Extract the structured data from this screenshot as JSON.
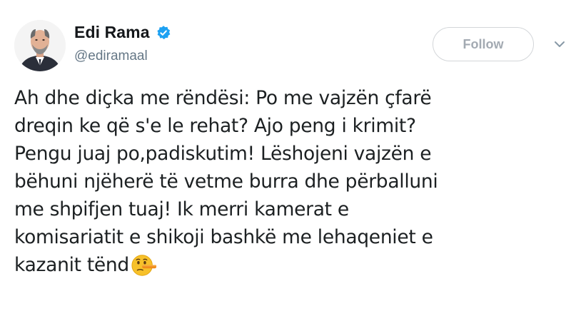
{
  "user": {
    "display_name": "Edi Rama",
    "handle": "@ediramaal"
  },
  "actions": {
    "follow_label": "Follow"
  },
  "tweet": {
    "lines": [
      "Ah dhe diçka me rëndësi: Po me vajzën çfarë",
      "dreqin ke që s'e le rehat? Ajo peng i krimit?",
      "Pengu juaj po,padiskutim! Lëshojeni vajzën e",
      "bëhuni njëherë të vetme burra dhe përballuni",
      "me shpifjen tuaj! Ik merri kamerat e",
      "komisariatit e shikoji bashkë me lehaqeniet e",
      "kazanit tënd"
    ],
    "emoji": "lying-face-emoji"
  },
  "icons": {
    "verified": "verified-badge-icon",
    "menu": "chevron-down-icon"
  },
  "colors": {
    "verified_blue": "#1da1f2",
    "text": "#1c2022",
    "secondary": "#657786"
  }
}
